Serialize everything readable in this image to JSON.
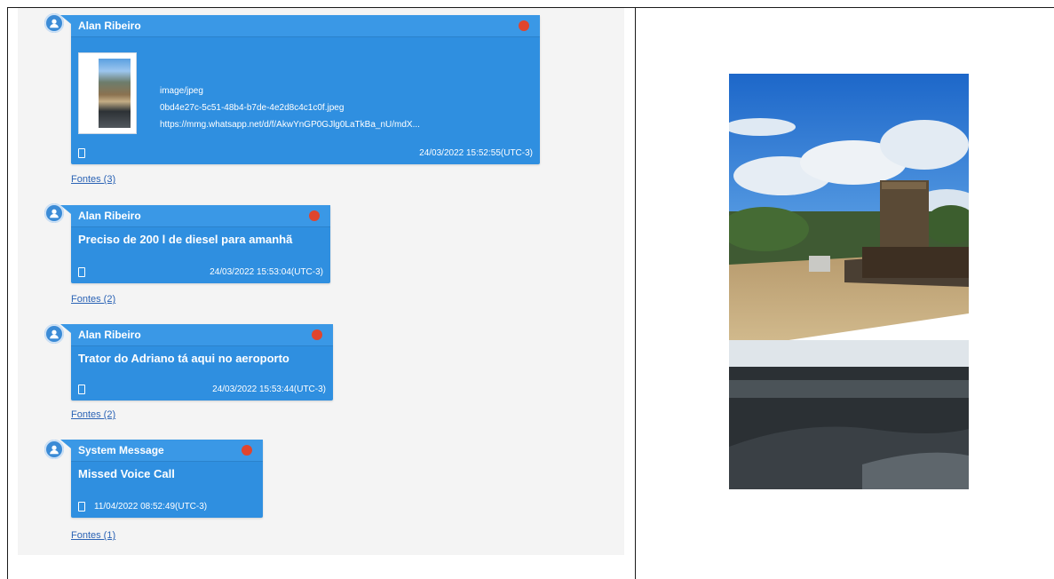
{
  "messages": [
    {
      "sender": "Alan Ribeiro",
      "attachment": {
        "mime": "image/jpeg",
        "filename": "0bd4e27c-5c51-48b4-b7de-4e2d8c4c1c0f.jpeg",
        "url": "https://mmg.whatsapp.net/d/f/AkwYnGP0GJlg0LaTkBa_nU/mdX..."
      },
      "timestamp": "24/03/2022 15:52:55(UTC-3)",
      "fontes": "Fontes (3)",
      "status_color": "#e0452e"
    },
    {
      "sender": "Alan Ribeiro",
      "text": "Preciso de 200 l de diesel para amanhã",
      "timestamp": "24/03/2022 15:53:04(UTC-3)",
      "fontes": "Fontes (2)",
      "status_color": "#e0452e"
    },
    {
      "sender": "Alan Ribeiro",
      "text": "Trator do Adriano tá aqui no aeroporto",
      "timestamp": "24/03/2022 15:53:44(UTC-3)",
      "fontes": "Fontes (2)",
      "status_color": "#e0452e"
    },
    {
      "sender": "System Message",
      "text": "Missed Voice Call",
      "timestamp": "11/04/2022 08:52:49(UTC-3)",
      "fontes": "Fontes (1)",
      "status_color": "#e0452e"
    }
  ],
  "icons": {
    "avatar": "user-icon",
    "device": "phone-icon",
    "status": "status-dot-icon"
  },
  "colors": {
    "bubble": "#2f8fe0",
    "link": "#2b63b5",
    "panel": "#f4f4f4"
  }
}
